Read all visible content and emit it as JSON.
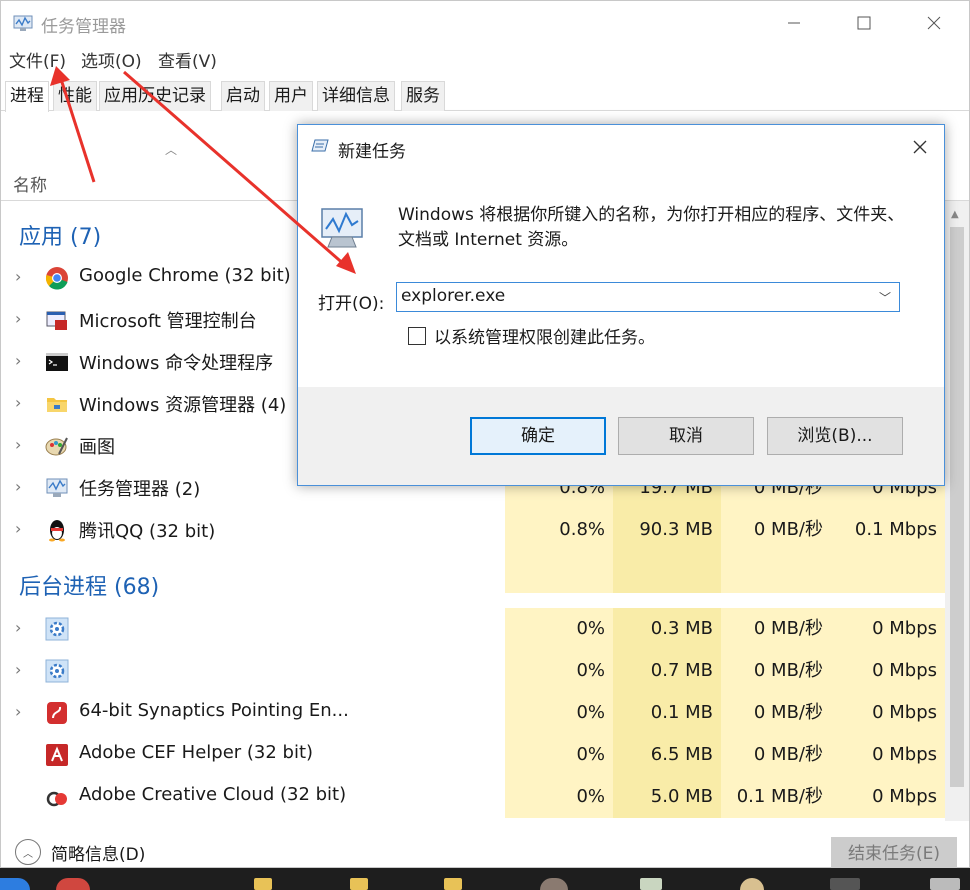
{
  "window": {
    "title": "任务管理器"
  },
  "menu": {
    "file": "文件(F)",
    "options": "选项(O)",
    "view": "查看(V)"
  },
  "tabs": [
    "进程",
    "性能",
    "应用历史记录",
    "启动",
    "用户",
    "详细信息",
    "服务"
  ],
  "columns": {
    "name": "名称"
  },
  "groups": {
    "apps": "应用 (7)",
    "background": "后台进程 (68)"
  },
  "apps": [
    {
      "name": "Google Chrome (32 bit)",
      "icon": "chrome-icon"
    },
    {
      "name": "Microsoft 管理控制台",
      "icon": "mmc-icon"
    },
    {
      "name": "Windows 命令处理程序",
      "icon": "cmd-icon"
    },
    {
      "name": "Windows 资源管理器 (4)",
      "icon": "explorer-folder-icon"
    },
    {
      "name": "画图",
      "icon": "paint-icon"
    },
    {
      "name": "任务管理器 (2)",
      "icon": "task-manager-icon",
      "cpu": "0.8%",
      "mem": "19.7 MB",
      "disk": "0 MB/秒",
      "net": "0 Mbps"
    },
    {
      "name": "腾讯QQ (32 bit)",
      "icon": "qq-penguin-icon",
      "cpu": "0.8%",
      "mem": "90.3 MB",
      "disk": "0 MB/秒",
      "net": "0.1 Mbps"
    }
  ],
  "background": [
    {
      "name": "",
      "icon": "gear-icon",
      "cpu": "0%",
      "mem": "0.3 MB",
      "disk": "0 MB/秒",
      "net": "0 Mbps"
    },
    {
      "name": "",
      "icon": "gear-icon",
      "cpu": "0%",
      "mem": "0.7 MB",
      "disk": "0 MB/秒",
      "net": "0 Mbps"
    },
    {
      "name": "64-bit Synaptics Pointing En...",
      "icon": "synaptics-icon",
      "cpu": "0%",
      "mem": "0.1 MB",
      "disk": "0 MB/秒",
      "net": "0 Mbps"
    },
    {
      "name": "Adobe CEF Helper (32 bit)",
      "icon": "adobe-icon",
      "cpu": "0%",
      "mem": "6.5 MB",
      "disk": "0 MB/秒",
      "net": "0 Mbps"
    },
    {
      "name": "Adobe Creative Cloud (32 bit)",
      "icon": "creative-cloud-icon",
      "cpu": "0%",
      "mem": "5.0 MB",
      "disk": "0.1 MB/秒",
      "net": "0 Mbps"
    }
  ],
  "footer": {
    "fewer_details": "简略信息(D)",
    "end_task": "结束任务(E)"
  },
  "dialog": {
    "title": "新建任务",
    "description": "Windows 将根据你所键入的名称，为你打开相应的程序、文件夹、文档或 Internet 资源。",
    "open_label": "打开(O):",
    "open_value": "explorer.exe",
    "admin_checkbox": "以系统管理权限创建此任务。",
    "ok": "确定",
    "cancel": "取消",
    "browse": "浏览(B)..."
  },
  "colors": {
    "accent": "#1e62b4",
    "cpu_fill": "#fff4c4",
    "mem_fill": "#f9eca8",
    "arrow": "#e8322b"
  }
}
